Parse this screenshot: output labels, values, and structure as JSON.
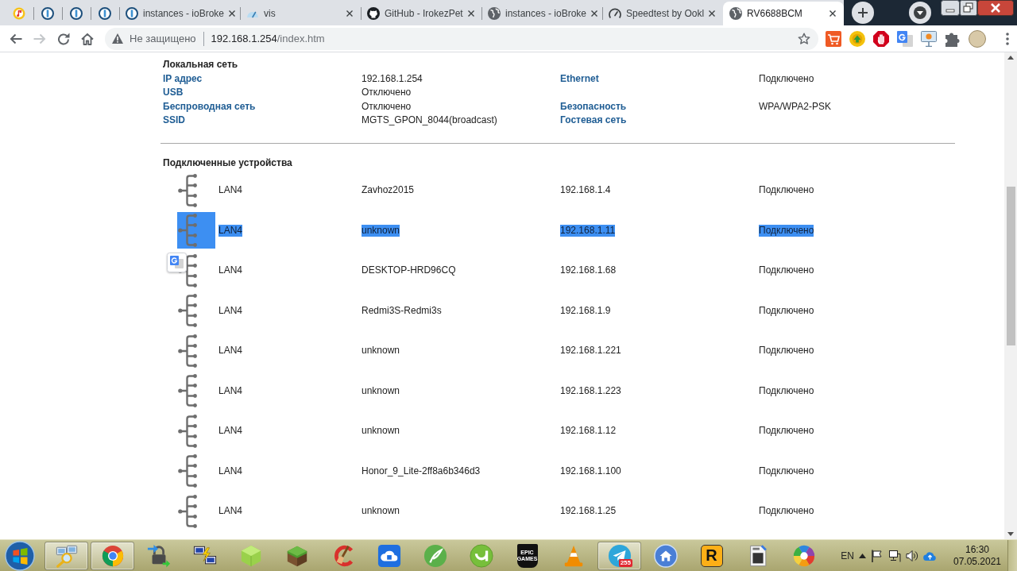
{
  "tabs": [
    {
      "kind": "music",
      "selected": false
    },
    {
      "kind": "ring-bar",
      "selected": false
    },
    {
      "kind": "ring-bar",
      "selected": false
    },
    {
      "kind": "ring-bar",
      "selected": false
    },
    {
      "kind": "ring-bar",
      "title": "instances - ioBroke",
      "selected": false
    },
    {
      "kind": "gauge-cloud",
      "title": "vis",
      "selected": false
    },
    {
      "kind": "cat",
      "title": "GitHub - IrokezPet",
      "selected": false
    },
    {
      "kind": "globe",
      "title": "instances - ioBroke",
      "selected": false
    },
    {
      "kind": "speedometer",
      "title": "Speedtest by Ookl",
      "selected": false
    },
    {
      "kind": "globe",
      "title": "RV6688BCM",
      "selected": true
    }
  ],
  "toolbar": {
    "nav": [
      {
        "kind": "back",
        "disabled": false
      },
      {
        "kind": "forward",
        "disabled": true
      },
      {
        "kind": "reload",
        "disabled": false
      },
      {
        "kind": "home",
        "disabled": false
      }
    ],
    "address": {
      "security": "Не защищено",
      "host": "192.168.1.254",
      "path": "/index.htm"
    }
  },
  "local_network": {
    "title": "Локальная сеть",
    "rows": [
      [
        {
          "label": "IP адрес",
          "value": "192.168.1.254"
        },
        {
          "label": "Ethernet",
          "value": "Подключено"
        }
      ],
      [
        {
          "label": "USB",
          "value": "Отключено"
        }
      ],
      [
        {
          "label": "Беспроводная сеть",
          "value": "Отключено"
        },
        {
          "label": "Безопасность",
          "value": "WPA/WPA2-PSK"
        }
      ],
      [
        {
          "label": "SSID",
          "value": "MGTS_GPON_8044(broadcast)"
        },
        {
          "label": "Гостевая сеть"
        }
      ]
    ]
  },
  "connected_devices": {
    "title": "Подключенные устройства",
    "rows": [
      {
        "port": "LAN4",
        "name": "Zavhoz2015",
        "ip": "192.168.1.4",
        "status": "Подключено",
        "selected": false
      },
      {
        "port": "LAN4",
        "name": "unknown",
        "ip": "192.168.1.11",
        "status": "Подключено",
        "selected": true
      },
      {
        "port": "LAN4",
        "name": "DESKTOP-HRD96CQ",
        "ip": "192.168.1.68",
        "status": "Подключено",
        "selected": false
      },
      {
        "port": "LAN4",
        "name": "Redmi3S-Redmi3s",
        "ip": "192.168.1.9",
        "status": "Подключено",
        "selected": false
      },
      {
        "port": "LAN4",
        "name": "unknown",
        "ip": "192.168.1.221",
        "status": "Подключено",
        "selected": false
      },
      {
        "port": "LAN4",
        "name": "unknown",
        "ip": "192.168.1.223",
        "status": "Подключено",
        "selected": false
      },
      {
        "port": "LAN4",
        "name": "unknown",
        "ip": "192.168.1.12",
        "status": "Подключено",
        "selected": false
      },
      {
        "port": "LAN4",
        "name": "Honor_9_Lite-2ff8a6b346d3",
        "ip": "192.168.1.100",
        "status": "Подключено",
        "selected": false
      },
      {
        "port": "LAN4",
        "name": "unknown",
        "ip": "192.168.1.25",
        "status": "Подключено",
        "selected": false
      }
    ]
  },
  "taskbar": {
    "items": [
      {
        "kind": "computers-search",
        "open": true
      },
      {
        "kind": "ring",
        "open": true
      },
      {
        "kind": "padlock",
        "open": false
      },
      {
        "kind": "computers-bolt",
        "open": false
      },
      {
        "kind": "cube",
        "open": false
      },
      {
        "kind": "grass-block",
        "open": false
      },
      {
        "kind": "brush",
        "open": false
      },
      {
        "kind": "cloud-chip",
        "open": false
      },
      {
        "kind": "quill",
        "open": false
      },
      {
        "kind": "smile-circle",
        "open": false
      },
      {
        "kind": "shield",
        "open": false,
        "logo_text": "EPIC GAMES"
      },
      {
        "kind": "cone",
        "open": false
      },
      {
        "kind": "plane",
        "open": true,
        "badge": "255"
      },
      {
        "kind": "house",
        "open": false
      },
      {
        "kind": "r-tile",
        "open": false,
        "logo_text": "R"
      },
      {
        "kind": "document",
        "open": false
      },
      {
        "kind": "pinwheel",
        "open": false
      }
    ],
    "language": "EN",
    "time": "16:30",
    "date": "07.05.2021"
  }
}
